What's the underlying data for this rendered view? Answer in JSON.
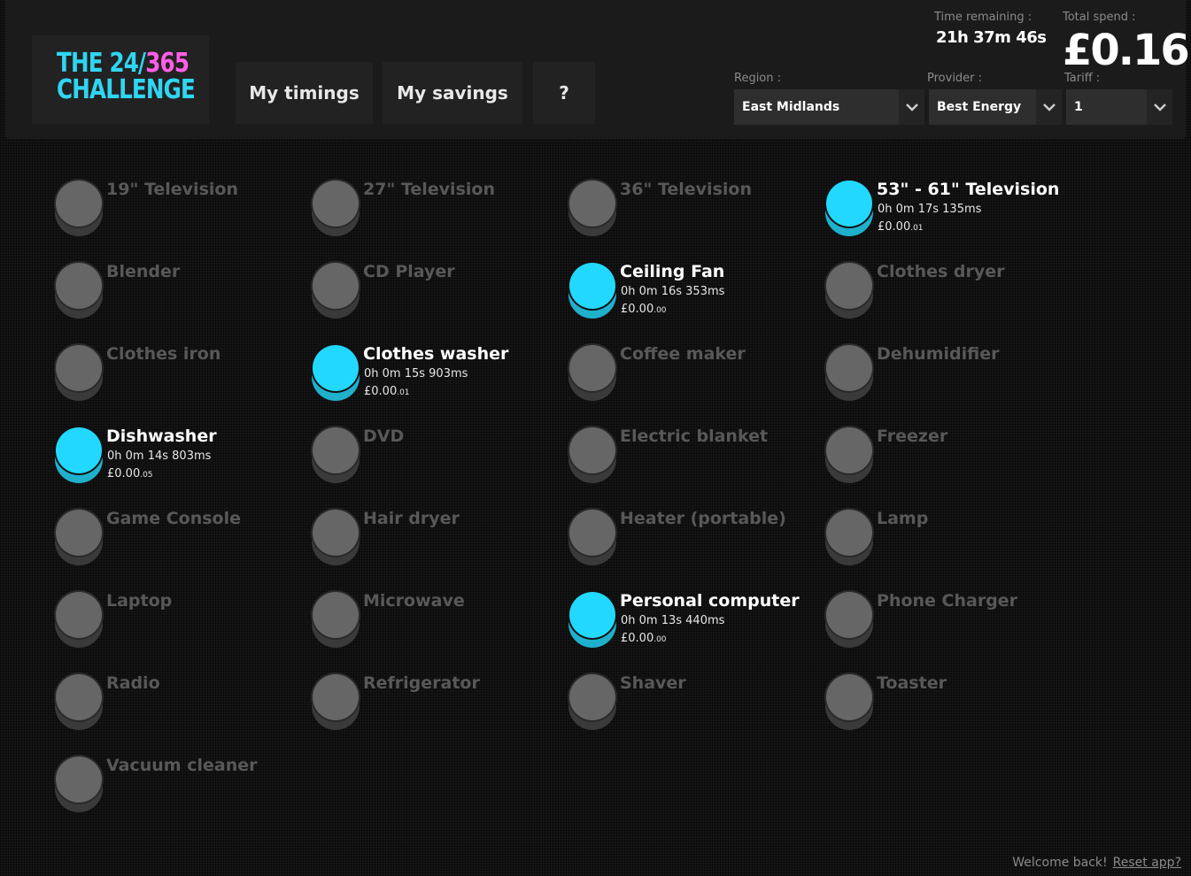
{
  "logo": {
    "line1_a": "THE 24/",
    "line1_b": "365",
    "line2": "CHALLENGE"
  },
  "nav": {
    "timings": "My timings",
    "savings": "My savings",
    "help": "?"
  },
  "stats": {
    "time_label": "Time remaining :",
    "time_value": "21h 37m 46s",
    "spend_label": "Total spend :",
    "spend_value": "£0.16"
  },
  "selectors": {
    "region_label": "Region :",
    "region_value": "East Midlands",
    "provider_label": "Provider :",
    "provider_value": "Best Energy",
    "tariff_label": "Tariff :",
    "tariff_value": "1"
  },
  "appliances": [
    {
      "name": "19\" Television",
      "on": false
    },
    {
      "name": "27\" Television",
      "on": false
    },
    {
      "name": "36\" Television",
      "on": false
    },
    {
      "name": "53\" - 61\" Television",
      "on": true,
      "time": "0h 0m 17s 135ms",
      "cost": "£0.00",
      "cost_small": ".01"
    },
    {
      "name": "Blender",
      "on": false
    },
    {
      "name": "CD Player",
      "on": false
    },
    {
      "name": "Ceiling Fan",
      "on": true,
      "time": "0h 0m 16s 353ms",
      "cost": "£0.00",
      "cost_small": ".00"
    },
    {
      "name": "Clothes dryer",
      "on": false
    },
    {
      "name": "Clothes iron",
      "on": false
    },
    {
      "name": "Clothes washer",
      "on": true,
      "time": "0h 0m 15s 903ms",
      "cost": "£0.00",
      "cost_small": ".01"
    },
    {
      "name": "Coffee maker",
      "on": false
    },
    {
      "name": "Dehumidifier",
      "on": false
    },
    {
      "name": "Dishwasher",
      "on": true,
      "time": "0h 0m 14s 803ms",
      "cost": "£0.00",
      "cost_small": ".05"
    },
    {
      "name": "DVD",
      "on": false
    },
    {
      "name": "Electric blanket",
      "on": false
    },
    {
      "name": "Freezer",
      "on": false
    },
    {
      "name": "Game Console",
      "on": false
    },
    {
      "name": "Hair dryer",
      "on": false
    },
    {
      "name": "Heater (portable)",
      "on": false
    },
    {
      "name": "Lamp",
      "on": false
    },
    {
      "name": "Laptop",
      "on": false
    },
    {
      "name": "Microwave",
      "on": false
    },
    {
      "name": "Personal computer",
      "on": true,
      "time": "0h 0m 13s 440ms",
      "cost": "£0.00",
      "cost_small": ".00"
    },
    {
      "name": "Phone Charger",
      "on": false
    },
    {
      "name": "Radio",
      "on": false
    },
    {
      "name": "Refrigerator",
      "on": false
    },
    {
      "name": "Shaver",
      "on": false
    },
    {
      "name": "Toaster",
      "on": false
    },
    {
      "name": "Vacuum cleaner",
      "on": false
    }
  ],
  "footer": {
    "welcome": "Welcome back!",
    "reset": "Reset app?"
  },
  "colors": {
    "accent": "#22d8ff",
    "logo_pink": "#ff5ee8",
    "off": "#666666"
  }
}
